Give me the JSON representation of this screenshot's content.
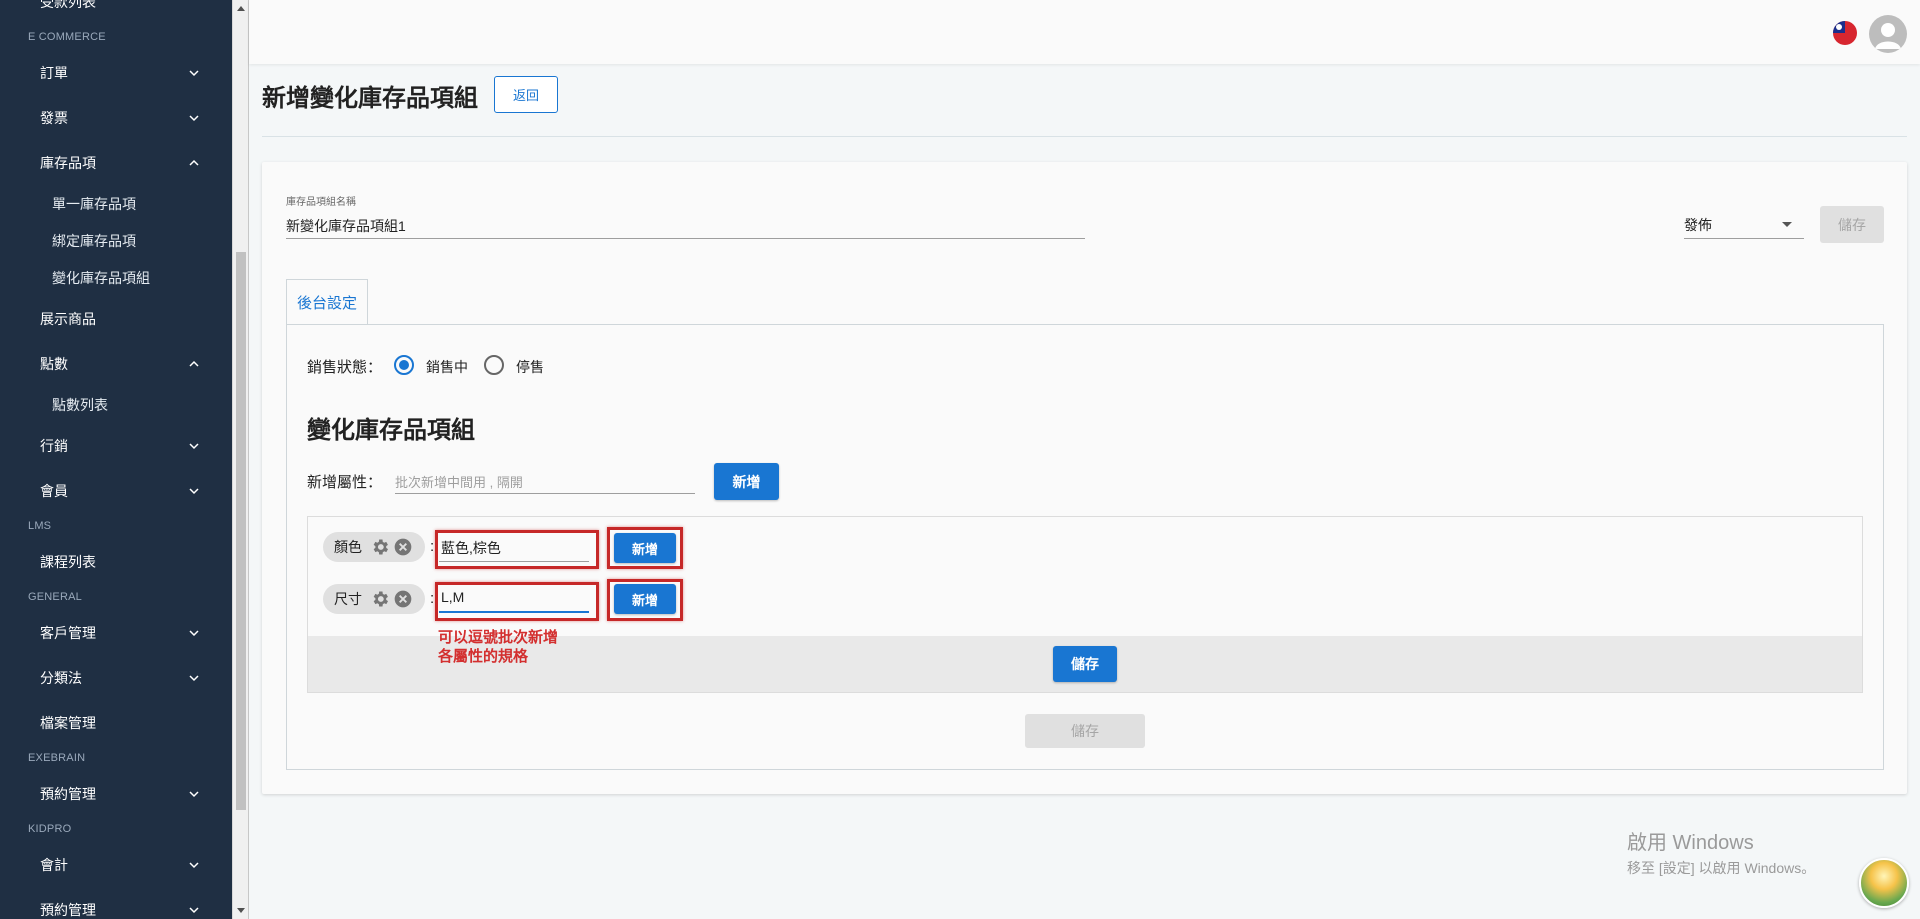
{
  "sidebar": {
    "sections": [
      {
        "key": "top_cut",
        "label": "受款列表"
      },
      {
        "key": "ecommerce",
        "label": "E COMMERCE"
      },
      {
        "key": "lms",
        "label": "LMS"
      },
      {
        "key": "general",
        "label": "GENERAL"
      },
      {
        "key": "exebrain",
        "label": "EXEBRAIN"
      },
      {
        "key": "kidpro",
        "label": "KIDPRO"
      }
    ],
    "items": {
      "orders": "訂單",
      "invoices": "發票",
      "inventory": "庫存品項",
      "inventory_single": "單一庫存品項",
      "inventory_bound": "綁定庫存品項",
      "inventory_variant": "變化庫存品項組",
      "showcase": "展示商品",
      "points": "點數",
      "points_list": "點數列表",
      "marketing": "行銷",
      "members": "會員",
      "courses": "課程列表",
      "customers": "客戶管理",
      "taxonomy": "分類法",
      "files": "檔案管理",
      "booking": "預約管理",
      "accounting": "會計",
      "booking2": "預約管理"
    }
  },
  "header": {
    "title": "新增變化庫存品項組",
    "back_label": "返回"
  },
  "form": {
    "name_label": "庫存品項組名稱",
    "name_value": "新變化庫存品項組1",
    "publish_value": "發佈",
    "save_label": "儲存"
  },
  "tabs": [
    {
      "label": "後台設定",
      "active": true
    }
  ],
  "sales_status": {
    "label": "銷售狀態：",
    "options": [
      {
        "label": "銷售中",
        "selected": true
      },
      {
        "label": "停售",
        "selected": false
      }
    ]
  },
  "variant": {
    "section_title": "變化庫存品項組",
    "add_attr_label": "新增屬性：",
    "add_attr_placeholder": "批次新增中間用 , 隔開",
    "add_button": "新增",
    "attributes": [
      {
        "name": "顏色",
        "value": "藍色,棕色",
        "add_label": "新增"
      },
      {
        "name": "尺寸",
        "value": "L,M",
        "add_label": "新增"
      }
    ],
    "colon": ":",
    "save_label": "儲存"
  },
  "annotation": {
    "line1": "可以逗號批次新增",
    "line2": "各屬性的規格"
  },
  "bottom_save_label": "儲存",
  "watermark": {
    "line1": "啟用 Windows",
    "line2": "移至 [設定] 以啟用 Windows。"
  },
  "colors": {
    "sidebar_bg": "#1f2f43",
    "primary": "#1976d2",
    "annotation_red": "#c62828"
  }
}
